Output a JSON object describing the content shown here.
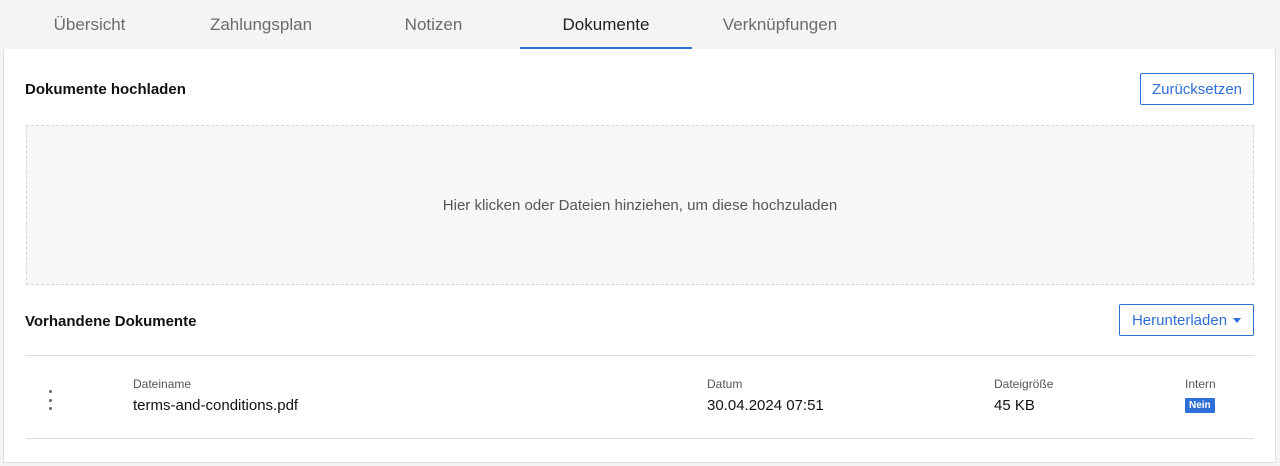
{
  "tabs": [
    {
      "label": "Übersicht",
      "active": false
    },
    {
      "label": "Zahlungsplan",
      "active": false
    },
    {
      "label": "Notizen",
      "active": false
    },
    {
      "label": "Dokumente",
      "active": true
    },
    {
      "label": "Verknüpfungen",
      "active": false
    }
  ],
  "upload": {
    "title": "Dokumente hochladen",
    "reset_label": "Zurücksetzen",
    "dropzone_text": "Hier klicken oder Dateien hinziehen, um diese hochzuladen"
  },
  "existing": {
    "title": "Vorhandene Dokumente",
    "download_label": "Herunterladen",
    "columns": {
      "filename": "Dateiname",
      "date": "Datum",
      "size": "Dateigröße",
      "internal": "Intern"
    },
    "rows": [
      {
        "filename": "terms-and-conditions.pdf",
        "date": "30.04.2024 07:51",
        "size": "45 KB",
        "internal": "Nein"
      }
    ]
  },
  "icons": {
    "row_menu": "kebab-menu-icon",
    "dropdown": "caret-down-icon"
  },
  "colors": {
    "accent": "#2f6fd8",
    "background": "#f4f4f4",
    "panel": "#ffffff"
  }
}
